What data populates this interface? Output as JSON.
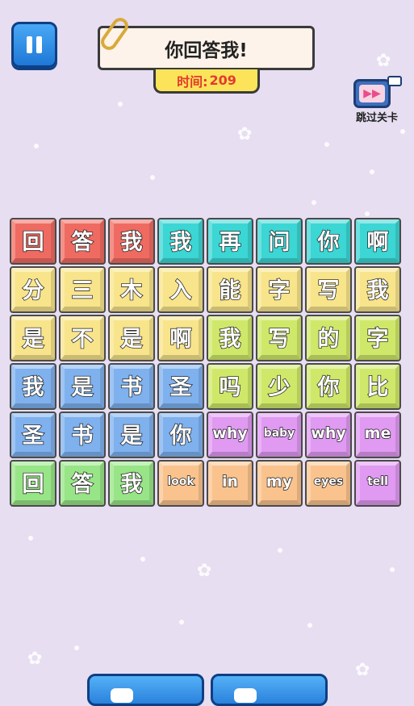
{
  "header": {
    "title": "你回答我!",
    "timer_label": "时间:",
    "timer_value": "209",
    "skip_label": "跳过关卡"
  },
  "board": {
    "rows": [
      [
        {
          "t": "回",
          "c": "red"
        },
        {
          "t": "答",
          "c": "red"
        },
        {
          "t": "我",
          "c": "red"
        },
        {
          "t": "我",
          "c": "cyan"
        },
        {
          "t": "再",
          "c": "cyan"
        },
        {
          "t": "问",
          "c": "cyan"
        },
        {
          "t": "你",
          "c": "cyan"
        },
        {
          "t": "啊",
          "c": "cyan"
        }
      ],
      [
        {
          "t": "分",
          "c": "yellow"
        },
        {
          "t": "三",
          "c": "yellow"
        },
        {
          "t": "木",
          "c": "yellow"
        },
        {
          "t": "入",
          "c": "yellow"
        },
        {
          "t": "能",
          "c": "yellow"
        },
        {
          "t": "字",
          "c": "yellow"
        },
        {
          "t": "写",
          "c": "yellow"
        },
        {
          "t": "我",
          "c": "yellow"
        }
      ],
      [
        {
          "t": "是",
          "c": "yellow"
        },
        {
          "t": "不",
          "c": "yellow"
        },
        {
          "t": "是",
          "c": "yellow"
        },
        {
          "t": "啊",
          "c": "yellow"
        },
        {
          "t": "我",
          "c": "lime"
        },
        {
          "t": "写",
          "c": "lime"
        },
        {
          "t": "的",
          "c": "lime"
        },
        {
          "t": "字",
          "c": "lime"
        }
      ],
      [
        {
          "t": "我",
          "c": "blue"
        },
        {
          "t": "是",
          "c": "blue"
        },
        {
          "t": "书",
          "c": "blue"
        },
        {
          "t": "圣",
          "c": "blue"
        },
        {
          "t": "吗",
          "c": "lime"
        },
        {
          "t": "少",
          "c": "lime"
        },
        {
          "t": "你",
          "c": "lime"
        },
        {
          "t": "比",
          "c": "lime"
        }
      ],
      [
        {
          "t": "圣",
          "c": "blue"
        },
        {
          "t": "书",
          "c": "blue"
        },
        {
          "t": "是",
          "c": "blue"
        },
        {
          "t": "你",
          "c": "blue"
        },
        {
          "t": "why",
          "c": "purple"
        },
        {
          "t": "baby",
          "c": "purple"
        },
        {
          "t": "why",
          "c": "purple"
        },
        {
          "t": "me",
          "c": "purple"
        }
      ],
      [
        {
          "t": "回",
          "c": "green"
        },
        {
          "t": "答",
          "c": "green"
        },
        {
          "t": "我",
          "c": "green"
        },
        {
          "t": "look",
          "c": "orange"
        },
        {
          "t": "in",
          "c": "orange"
        },
        {
          "t": "my",
          "c": "orange"
        },
        {
          "t": "eyes",
          "c": "orange"
        },
        {
          "t": "tell",
          "c": "purple"
        }
      ]
    ]
  },
  "colors": {
    "background": "#e7def2",
    "pause_button": "#2a8ae6",
    "timer_bg": "#fbe45a",
    "timer_text": "#e43a2f"
  },
  "icons": {
    "pause": "pause-icon",
    "skip": "tv-fast-forward-icon",
    "clip": "paperclip-icon"
  }
}
